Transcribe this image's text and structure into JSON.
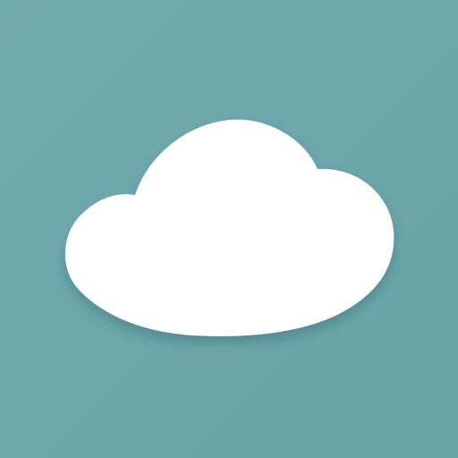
{
  "icon": {
    "name": "cloud-icon",
    "background_color": "#67a3a7",
    "background_highlight_color": "#72abaf",
    "cloud_color": "#ffffff",
    "shadow_color": "#1f4f53"
  }
}
